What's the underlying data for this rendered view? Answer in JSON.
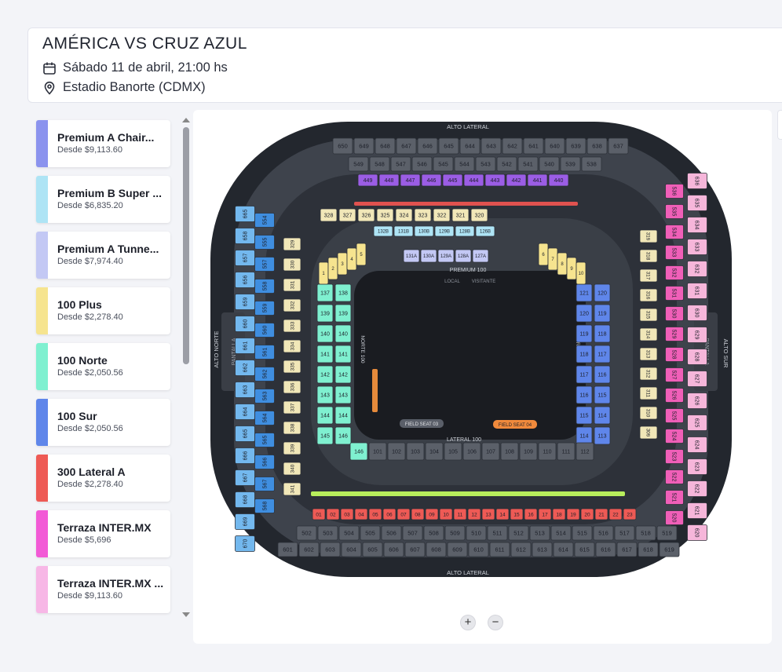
{
  "event": {
    "title": "AMÉRICA VS CRUZ AZUL",
    "date": "Sábado 11 de abril, 21:00 hs",
    "venue": "Estadio Banorte (CDMX)"
  },
  "tickets": [
    {
      "name": "Premium A Chair...",
      "price": "Desde $9,113.60",
      "color": "#8b93ee"
    },
    {
      "name": "Premium B Super ...",
      "price": "Desde $6,835.20",
      "color": "#aee4f5"
    },
    {
      "name": "Premium A Tunne...",
      "price": "Desde $7,974.40",
      "color": "#c3c8f4"
    },
    {
      "name": "100 Plus",
      "price": "Desde $2,278.40",
      "color": "#f6e48f"
    },
    {
      "name": "100 Norte",
      "price": "Desde $2,050.56",
      "color": "#7ff0d0"
    },
    {
      "name": "100 Sur",
      "price": "Desde $2,050.56",
      "color": "#5f86ea"
    },
    {
      "name": "300 Lateral A",
      "price": "Desde $2,278.40",
      "color": "#ee5a55"
    },
    {
      "name": "Terraza INTER.MX",
      "price": "Desde $5,696",
      "color": "#f25ad6"
    },
    {
      "name": "Terraza INTER.MX ...",
      "price": "Desde $9,113.60",
      "color": "#f7b7e6"
    }
  ],
  "map": {
    "labels": {
      "alto_lateral_top": "ALTO LATERAL",
      "alto_lateral_bottom": "ALTO LATERAL",
      "alto_norte": "ALTO NORTE",
      "alto_sur": "ALTO SUR",
      "pantalla_left": "PANTALLA",
      "pantalla_right": "PANTALLA",
      "premium": "PREMIUM 100",
      "local": "LOCAL",
      "visitante": "VISITANTE",
      "norte100": "NORTE 100",
      "sur100": "SUR 100",
      "lateral100": "LATERAL 100",
      "field_seat_03": "FIELD SEAT 03",
      "field_seat_04": "FIELD SEAT 04"
    },
    "sections": {
      "top_600": [
        "650",
        "649",
        "648",
        "647",
        "646",
        "645",
        "644",
        "643",
        "642",
        "641",
        "640",
        "639",
        "638",
        "637"
      ],
      "top_500": [
        "549",
        "548",
        "547",
        "546",
        "545",
        "544",
        "543",
        "542",
        "541",
        "540",
        "539",
        "538"
      ],
      "top_400": [
        "449",
        "448",
        "447",
        "446",
        "445",
        "444",
        "443",
        "442",
        "441",
        "440"
      ],
      "top_300": [
        "328",
        "327",
        "326",
        "325",
        "324",
        "323",
        "322",
        "321",
        "320"
      ],
      "left_600": [
        "665",
        "658",
        "657",
        "656",
        "659",
        "660",
        "661",
        "662",
        "663",
        "664",
        "665",
        "666",
        "667",
        "668",
        "669",
        "670"
      ],
      "left_500": [
        "554",
        "555",
        "557",
        "558",
        "559",
        "560",
        "561",
        "562",
        "563",
        "564",
        "565",
        "566",
        "567",
        "568"
      ],
      "left_300": [
        "329",
        "330",
        "331",
        "332",
        "333",
        "334",
        "335",
        "336",
        "337",
        "338",
        "339",
        "340",
        "341"
      ],
      "right_600": [
        "636",
        "635",
        "634",
        "633",
        "632",
        "631",
        "630",
        "629",
        "628",
        "627",
        "626",
        "625",
        "624",
        "623",
        "622",
        "621",
        "620"
      ],
      "right_500": [
        "536",
        "535",
        "534",
        "533",
        "532",
        "531",
        "530",
        "529",
        "528",
        "527",
        "526",
        "525",
        "524",
        "523",
        "522",
        "521",
        "520"
      ],
      "right_300": [
        "319",
        "318",
        "317",
        "316",
        "315",
        "314",
        "313",
        "312",
        "311",
        "310",
        "309"
      ],
      "bottom_600": [
        "601",
        "602",
        "603",
        "604",
        "605",
        "606",
        "607",
        "608",
        "609",
        "610",
        "611",
        "612",
        "613",
        "614",
        "615",
        "616",
        "617",
        "618",
        "619"
      ],
      "bottom_500": [
        "502",
        "503",
        "504",
        "505",
        "506",
        "507",
        "508",
        "509",
        "510",
        "511",
        "512",
        "513",
        "514",
        "515",
        "516",
        "517",
        "518",
        "519"
      ],
      "bottom_red": [
        "01",
        "02",
        "03",
        "04",
        "05",
        "06",
        "07",
        "08",
        "09",
        "10",
        "11",
        "12",
        "13",
        "14",
        "15",
        "16",
        "17",
        "18",
        "19",
        "20",
        "21",
        "22",
        "23"
      ],
      "norte_100": [
        [
          "137",
          "138"
        ],
        [
          "139",
          "139"
        ],
        [
          "140",
          "140"
        ],
        [
          "141",
          "141"
        ],
        [
          "142",
          "142"
        ],
        [
          "143",
          "143"
        ],
        [
          "144",
          "144"
        ],
        [
          "145",
          "146"
        ]
      ],
      "sur_100": [
        [
          "121",
          "120"
        ],
        [
          "120",
          "119"
        ],
        [
          "119",
          "118"
        ],
        [
          "118",
          "117"
        ],
        [
          "117",
          "116"
        ],
        [
          "116",
          "115"
        ],
        [
          "115",
          "114"
        ],
        [
          "114",
          "113"
        ]
      ],
      "lateral_100": [
        "146",
        "101",
        "102",
        "103",
        "104",
        "105",
        "106",
        "107",
        "108",
        "109",
        "110",
        "111",
        "112"
      ],
      "premium_a": [
        "131A",
        "130A",
        "129A",
        "128A",
        "127A"
      ],
      "premium_b": [
        "132B",
        "131B",
        "130B",
        "129B",
        "128B",
        "126B"
      ],
      "plus_100": [
        "1",
        "2",
        "3",
        "4",
        "5",
        "6",
        "7",
        "8",
        "9",
        "10"
      ]
    }
  },
  "zoom": {
    "in": "+",
    "out": "−"
  }
}
